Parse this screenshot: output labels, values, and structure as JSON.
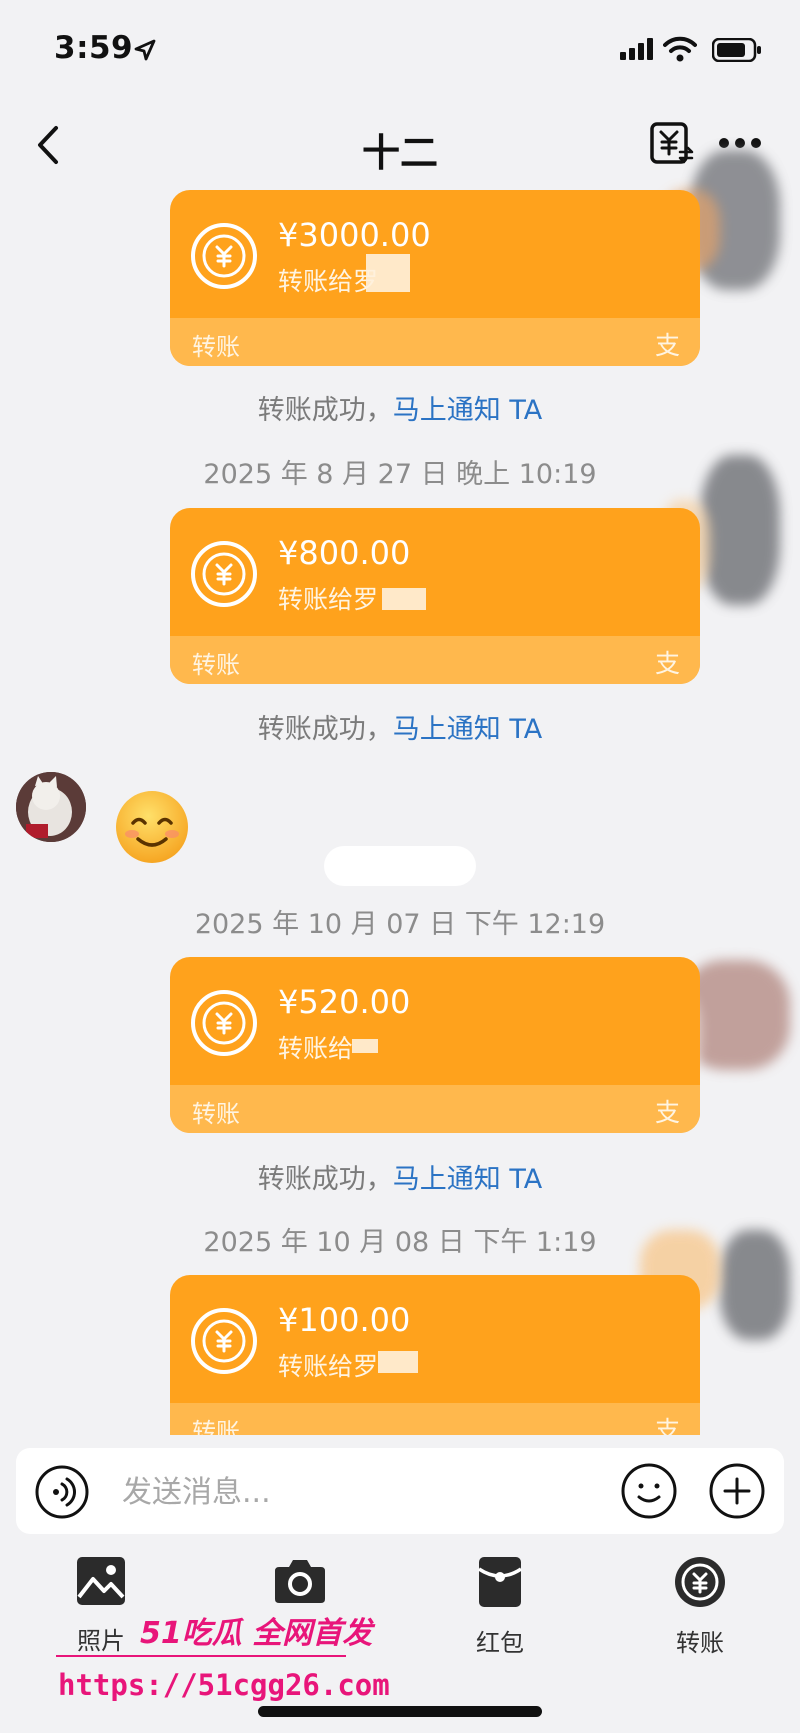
{
  "status_bar": {
    "time": "3:59"
  },
  "chat": {
    "title": "十二"
  },
  "icons": {
    "back": "chevron-left-icon",
    "transfer": "yuan-transfer-icon",
    "more": "more-dots-icon"
  },
  "messages": {
    "transfers": [
      {
        "amount": "¥3000.00",
        "desc": "转账给罗",
        "label": "转账",
        "badge": "支"
      },
      {
        "amount": "¥800.00",
        "desc": "转账给罗",
        "label": "转账",
        "badge": "支"
      },
      {
        "amount": "¥520.00",
        "desc": "转账给",
        "label": "转账",
        "badge": "支"
      },
      {
        "amount": "¥100.00",
        "desc": "转账给罗",
        "label": "转账",
        "badge": "支"
      }
    ],
    "notice_text": "转账成功，",
    "notice_link": "马上通知 TA",
    "timestamps": [
      "2025 年 8 月 27 日 晚上 10:19",
      "2025 年 10 月 07 日 下午 12:19",
      "2025 年 10 月 08 日 下午 1:19"
    ]
  },
  "input": {
    "placeholder": "发送消息..."
  },
  "toolbar": [
    {
      "label": "照片",
      "icon": "photo-icon"
    },
    {
      "label": "",
      "icon": "camera-icon"
    },
    {
      "label": "红包",
      "icon": "red-packet-icon"
    },
    {
      "label": "转账",
      "icon": "transfer-icon"
    }
  ],
  "watermark": {
    "title": "51吃瓜 全网首发",
    "url": "https://51cgg26.com"
  },
  "colors": {
    "card": "#ffa21c",
    "card_footer": "#ffb84d",
    "link": "#2b73c4",
    "watermark": "#e8157a"
  }
}
